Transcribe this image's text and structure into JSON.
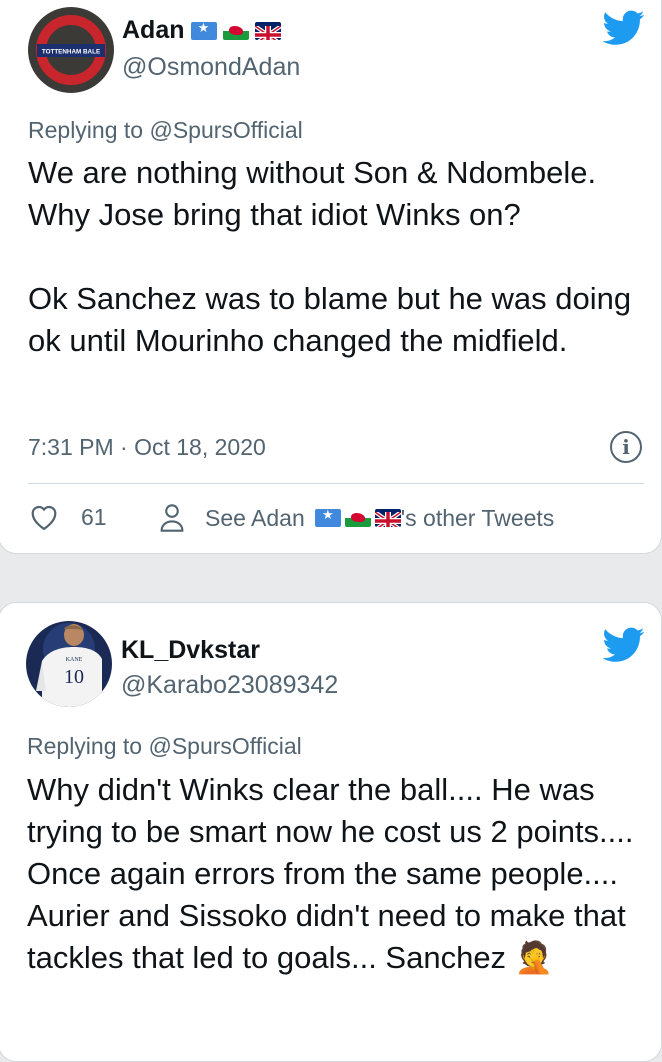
{
  "tweets": [
    {
      "display_name": "Adan",
      "handle": "@OsmondAdan",
      "avatar_text": "TOTTENHAM BALE",
      "reply_prefix": "Replying to",
      "reply_to": "@SpursOfficial",
      "paragraphs": [
        "We are nothing without Son & Ndombele. Why Jose bring that idiot Winks on?",
        "Ok Sanchez was to blame but he was doing ok until Mourinho changed the midfield."
      ],
      "time": "7:31 PM · Oct 18, 2020",
      "likes": "61",
      "see_prefix": "See Adan",
      "see_suffix": "'s other Tweets",
      "info_icon": "i"
    },
    {
      "display_name": "KL_Dvkstar",
      "handle": "@Karabo23089342",
      "avatar_text": "10",
      "avatar_name": "KANE",
      "reply_prefix": "Replying to",
      "reply_to": "@SpursOfficial",
      "paragraphs": [
        "Why didn't Winks clear the ball.... He was trying to be smart now he cost us 2 points.... Once again errors from the same people.... Aurier and Sissoko didn't need to make that tackles that led to goals... Sanchez 🤦"
      ]
    }
  ],
  "colors": {
    "twitter_blue": "#1d9bf0",
    "secondary_text": "#536471",
    "primary_text": "#0f1419",
    "background": "#e9eaec"
  },
  "icons": [
    "twitter-bird-icon",
    "heart-icon",
    "person-icon",
    "info-icon",
    "somalia-flag-icon",
    "wales-flag-icon",
    "uk-flag-icon"
  ]
}
